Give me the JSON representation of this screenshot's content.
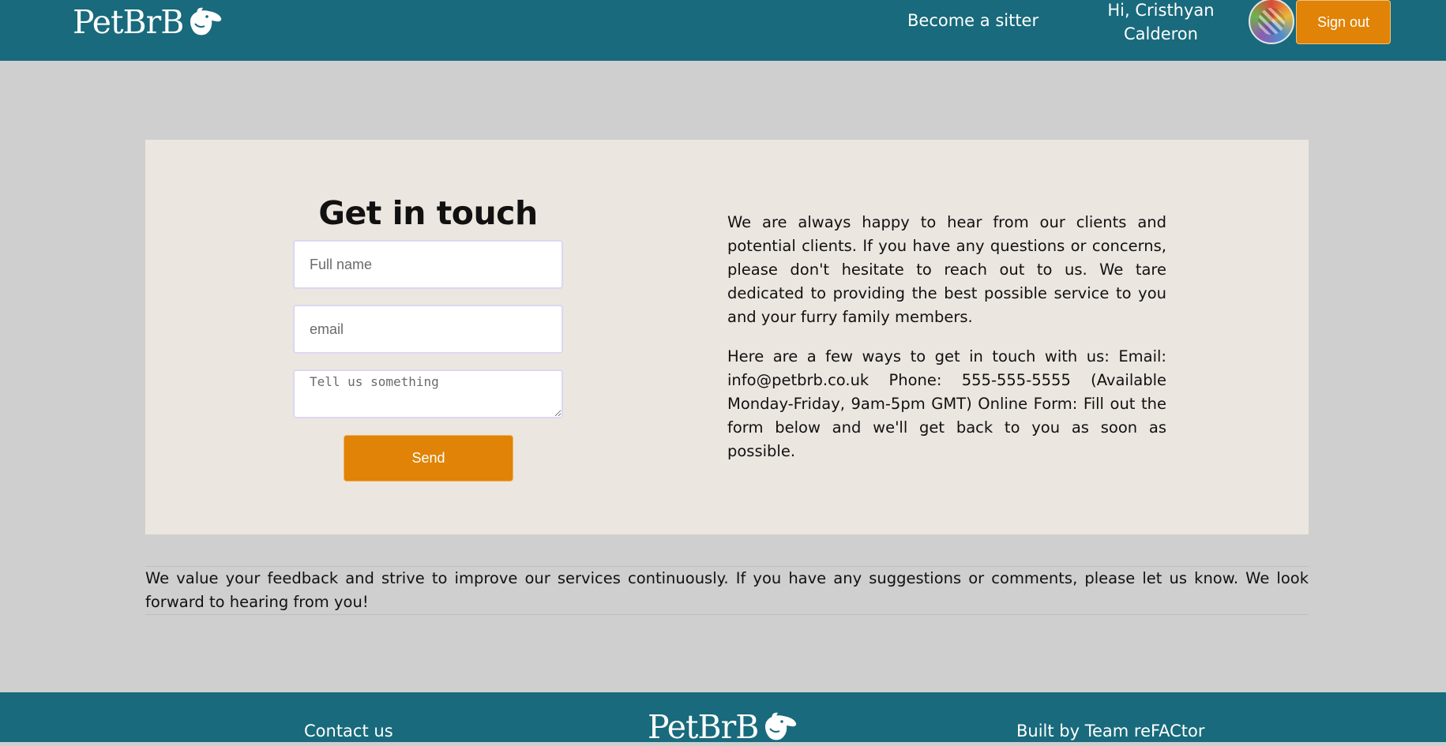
{
  "header": {
    "logo_text": "PetBrB",
    "nav_become_sitter": "Become a sitter",
    "greeting": "Hi, Cristhyan Calderon",
    "sign_out": "Sign out"
  },
  "contact_form": {
    "title": "Get in touch",
    "full_name_placeholder": "Full name",
    "email_placeholder": "email",
    "message_placeholder": "Tell us something",
    "send_label": "Send"
  },
  "info": {
    "paragraph_1": "We are always happy to hear from our clients and potential clients. If you have any questions or concerns, please don't hesitate to reach out to us. We tare dedicated to providing the best possible service to you and your furry family members.",
    "paragraph_2": "Here are a few ways to get in touch with us: Email: info@petbrb.co.uk Phone: 555-555-5555 (Available Monday-Friday, 9am-5pm GMT) Online Form: Fill out the form below and we'll get back to you as soon as possible."
  },
  "feedback": "We value your feedback and strive to improve our services continuously. If you have any suggestions or comments, please let us know. We look forward to hearing from you!",
  "footer": {
    "contact_us": "Contact us",
    "logo_text": "PetBrB",
    "credit": "Built by Team reFACtor"
  },
  "colors": {
    "brand_teal": "#186a7c",
    "accent_orange": "#e08306",
    "page_background": "#cfcfcf",
    "card_background": "#ece6e0"
  },
  "icons": {
    "logo": "dog-head-icon",
    "avatar": "user-avatar"
  }
}
